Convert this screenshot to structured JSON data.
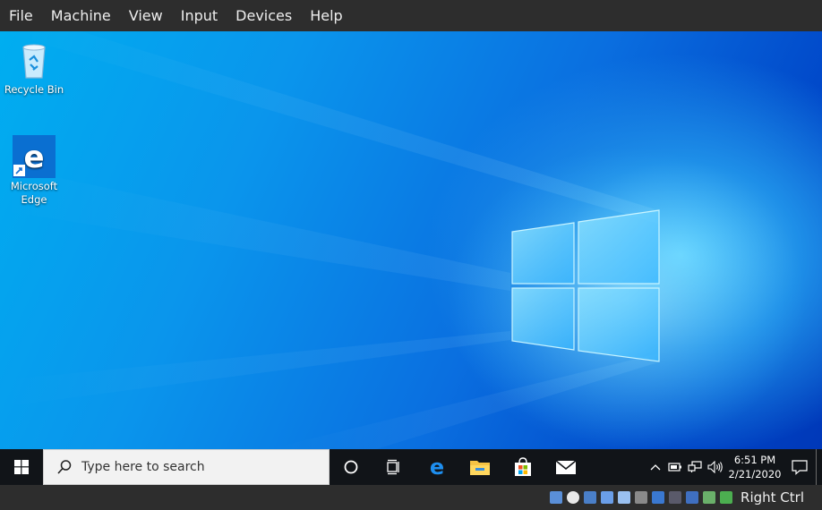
{
  "vbox_menu": {
    "items": [
      "File",
      "Machine",
      "View",
      "Input",
      "Devices",
      "Help"
    ]
  },
  "desktop": {
    "icons": [
      {
        "label": "Recycle Bin",
        "icon": "recycle-bin-icon"
      },
      {
        "label": "Microsoft Edge",
        "icon": "edge-icon"
      }
    ]
  },
  "taskbar": {
    "start_icon": "windows-logo-icon",
    "search_placeholder": "Type here to search",
    "pinned": [
      "cortana-icon",
      "task-view-icon",
      "edge-icon",
      "file-explorer-icon",
      "store-icon",
      "mail-icon"
    ],
    "tray_icons": [
      "chevron-up-icon",
      "battery-icon",
      "network-icon",
      "volume-icon"
    ],
    "time": "6:51 PM",
    "date": "2/21/2020",
    "notification_icon": "action-center-icon"
  },
  "vbox_status": {
    "icons": [
      "optical-drive-icon",
      "audio-icon",
      "network-adapter-icon",
      "usb-icon",
      "shared-folders-icon",
      "display-icon",
      "video-capture-icon",
      "recording-icon",
      "cpu-icon",
      "mouse-integration-icon",
      "keyboard-icon"
    ],
    "host_key": "Right Ctrl"
  },
  "colors": {
    "menubar": "#2d2d2d",
    "taskbar": "#111418",
    "accent": "#0078d7"
  }
}
